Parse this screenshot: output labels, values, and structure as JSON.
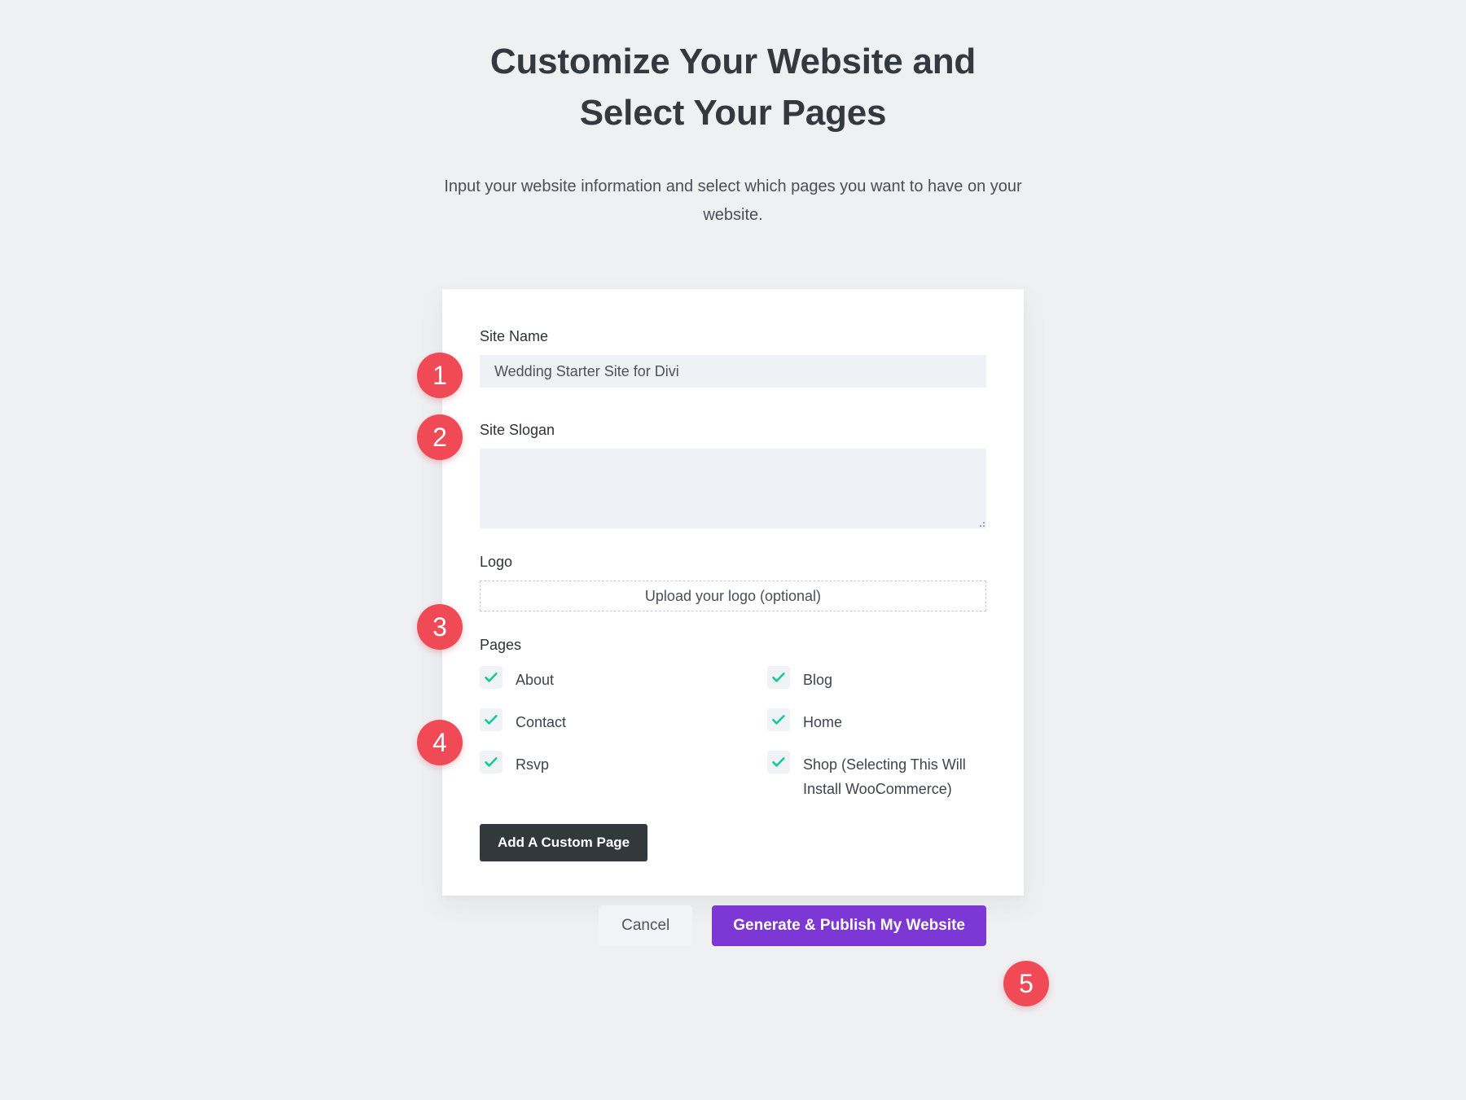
{
  "header": {
    "title": "Customize Your Website and Select Your Pages",
    "subtitle": "Input your website information and select which pages you want to have on your website."
  },
  "form": {
    "site_name": {
      "label": "Site Name",
      "value": "Wedding Starter Site for Divi",
      "placeholder": ""
    },
    "site_slogan": {
      "label": "Site Slogan",
      "value": "",
      "placeholder": ""
    },
    "logo": {
      "label": "Logo",
      "upload_text": "Upload your logo (optional)"
    },
    "pages": {
      "label": "Pages",
      "options": [
        {
          "label": "About",
          "checked": true
        },
        {
          "label": "Blog",
          "checked": true
        },
        {
          "label": "Contact",
          "checked": true
        },
        {
          "label": "Home",
          "checked": true
        },
        {
          "label": "Rsvp",
          "checked": true
        },
        {
          "label": "Shop (Selecting This Will Install WooCommerce)",
          "checked": true
        }
      ]
    },
    "add_custom_page_label": "Add A Custom Page",
    "cancel_label": "Cancel",
    "submit_label": "Generate & Publish My Website"
  },
  "badges": [
    {
      "number": "1"
    },
    {
      "number": "2"
    },
    {
      "number": "3"
    },
    {
      "number": "4"
    },
    {
      "number": "5"
    }
  ],
  "colors": {
    "background": "#eff0f2",
    "card": "#ffffff",
    "badge_red": "#ef4a56",
    "primary_purple": "#7c37d4",
    "dark_button": "#33383d",
    "input_bg": "#eef1f5",
    "check_green": "#18c79a"
  }
}
